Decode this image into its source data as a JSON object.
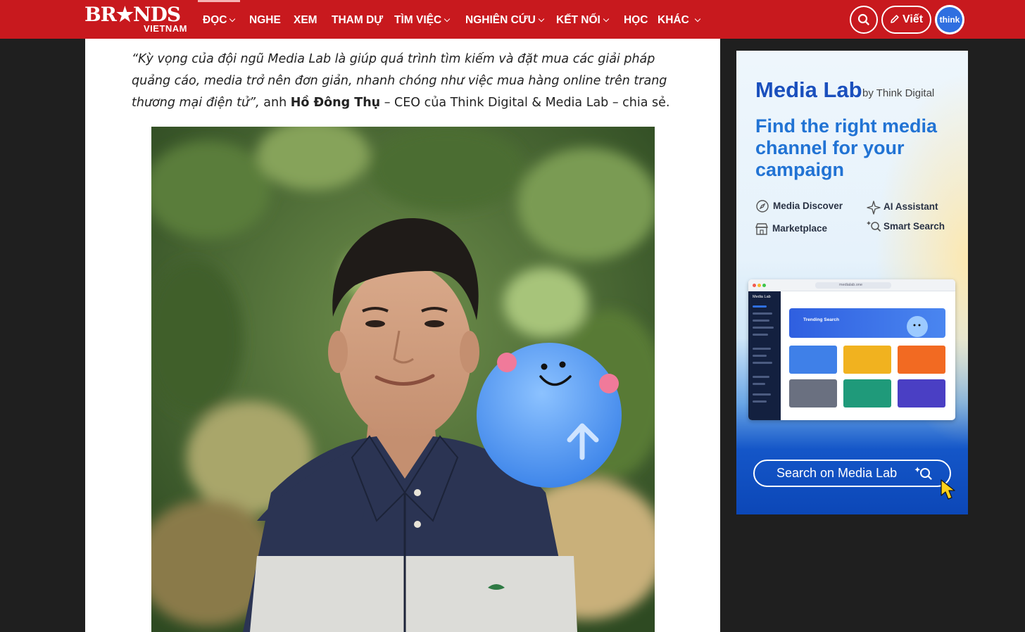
{
  "header": {
    "logo_top": "BR★NDS",
    "logo_bottom": "VIETNAM",
    "nav": [
      {
        "label": "ĐỌC",
        "dropdown": true
      },
      {
        "label": "NGHE",
        "dropdown": false
      },
      {
        "label": "XEM",
        "dropdown": false
      },
      {
        "label": "THAM DỰ",
        "dropdown": false
      },
      {
        "label": "TÌM VIỆC",
        "dropdown": true
      },
      {
        "label": "NGHIÊN CỨU",
        "dropdown": true
      },
      {
        "label": "KẾT NỐI",
        "dropdown": true
      },
      {
        "label": "HỌC",
        "dropdown": false
      },
      {
        "label": "KHÁC",
        "dropdown": true
      }
    ],
    "write_label": "Viết",
    "avatar_label": "think",
    "search_icon": "search-icon",
    "brand_color": "#c8191e"
  },
  "article": {
    "quote_italic": "“Kỳ vọng của đội ngũ Media Lab là giúp quá trình tìm kiếm và đặt mua các giải pháp quảng cáo, media trở nên đơn giản, nhanh chóng như việc mua hàng online trên trang thương mại điện tử”,",
    "quote_lead": " anh ",
    "quote_name": "Hồ Đông Thụ",
    "quote_tail": " – CEO của Think Digital & Media Lab – chia sẻ."
  },
  "ad": {
    "brand": "Media Lab",
    "brand_sub": "by Think Digital",
    "headline": "Find the right media channel for your campaign",
    "features": [
      {
        "label": "Media Discover",
        "icon": "compass-icon"
      },
      {
        "label": "AI Assistant",
        "icon": "sparkle-icon"
      },
      {
        "label": "Marketplace",
        "icon": "store-icon"
      },
      {
        "label": "Smart Search",
        "icon": "smart-search-icon"
      }
    ],
    "mock": {
      "app_name": "Media Lab",
      "url": "medialab.one",
      "banner_title": "Trending Search"
    },
    "cta": "Search on Media Lab",
    "accent_color": "#1a4fbd"
  }
}
